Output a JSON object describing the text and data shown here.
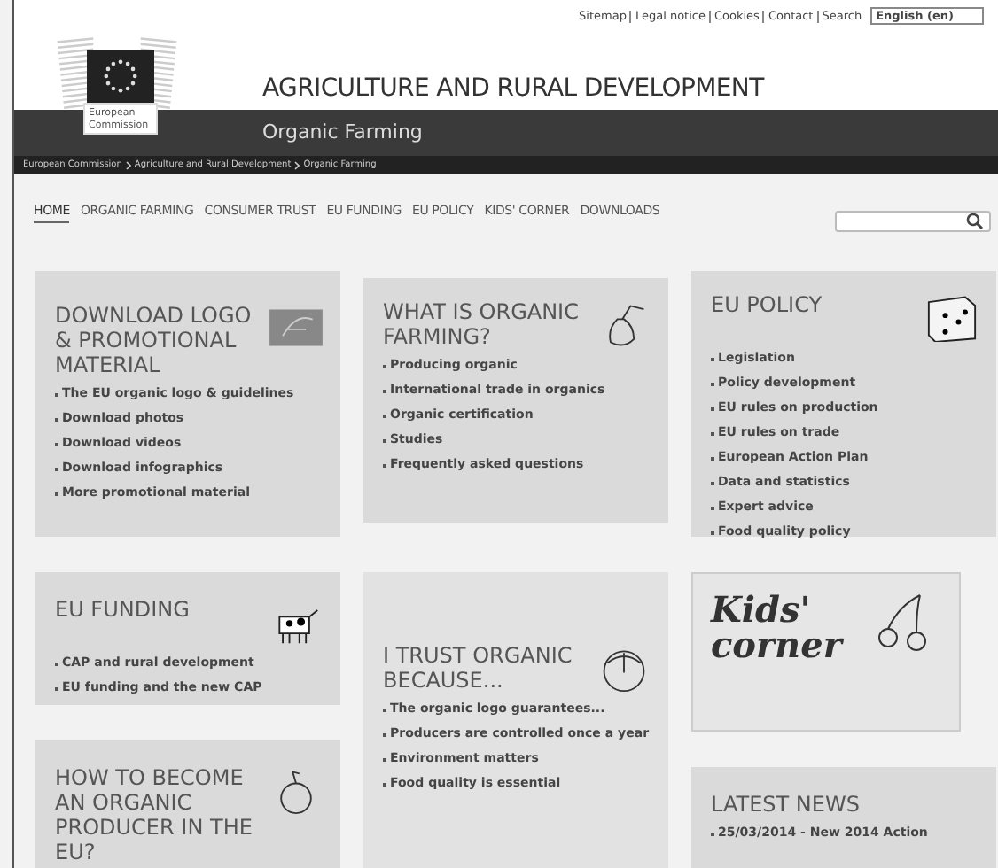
{
  "top_links": [
    "Sitemap",
    "Legal notice",
    "Cookies",
    "Contact",
    "Search"
  ],
  "language": "English (en)",
  "logo": {
    "caption": "European Commission"
  },
  "site_title": "AGRICULTURE AND RURAL DEVELOPMENT",
  "section_title": "Organic Farming",
  "breadcrumb": [
    "European Commission",
    "Agriculture and Rural Development",
    "Organic Farming"
  ],
  "nav": [
    {
      "label": "HOME",
      "selected": true
    },
    {
      "label": "ORGANIC FARMING",
      "selected": false
    },
    {
      "label": "CONSUMER TRUST",
      "selected": false
    },
    {
      "label": "EU FUNDING",
      "selected": false
    },
    {
      "label": "EU POLICY",
      "selected": false
    },
    {
      "label": "KIDS' CORNER",
      "selected": false
    },
    {
      "label": "DOWNLOADS",
      "selected": false
    }
  ],
  "columns": [
    {
      "cards": [
        {
          "kind": "links",
          "title": "DOWNLOAD LOGO & PROMOTIONAL MATERIAL",
          "items": [
            "The EU organic logo & guidelines",
            "Download photos",
            "Download videos",
            "Download infographics",
            "More promotional material"
          ]
        },
        {
          "kind": "links",
          "title": "EU FUNDING",
          "items": [
            "CAP and rural development",
            "EU funding and the new CAP"
          ]
        },
        {
          "kind": "links",
          "title": "HOW TO BECOME AN ORGANIC PRODUCER IN THE EU?"
        }
      ]
    },
    {
      "cards": [
        {
          "kind": "links",
          "title": "WHAT IS ORGANIC FARMING?",
          "items": [
            "Producing organic",
            "International trade in organics",
            "Organic certification",
            "Studies",
            "Frequently asked questions"
          ]
        },
        {
          "kind": "links",
          "title": "I TRUST ORGANIC BECAUSE...",
          "items": [
            "The organic logo guarantees...",
            "Producers are controlled once a year",
            "Environment matters",
            "Food quality is essential"
          ]
        }
      ]
    },
    {
      "cards": [
        {
          "kind": "links",
          "title": "EU POLICY",
          "items": [
            "Legislation",
            "Policy development",
            "EU rules on production",
            "EU rules on trade",
            "European Action Plan",
            "Data and statistics",
            "Expert advice",
            "Food quality policy"
          ]
        },
        {
          "kind": "promo",
          "title": "Kids' corner"
        },
        {
          "kind": "links",
          "title": "LATEST NEWS",
          "items": [
            "25/03/2014 - New 2014 Action"
          ]
        }
      ]
    }
  ]
}
